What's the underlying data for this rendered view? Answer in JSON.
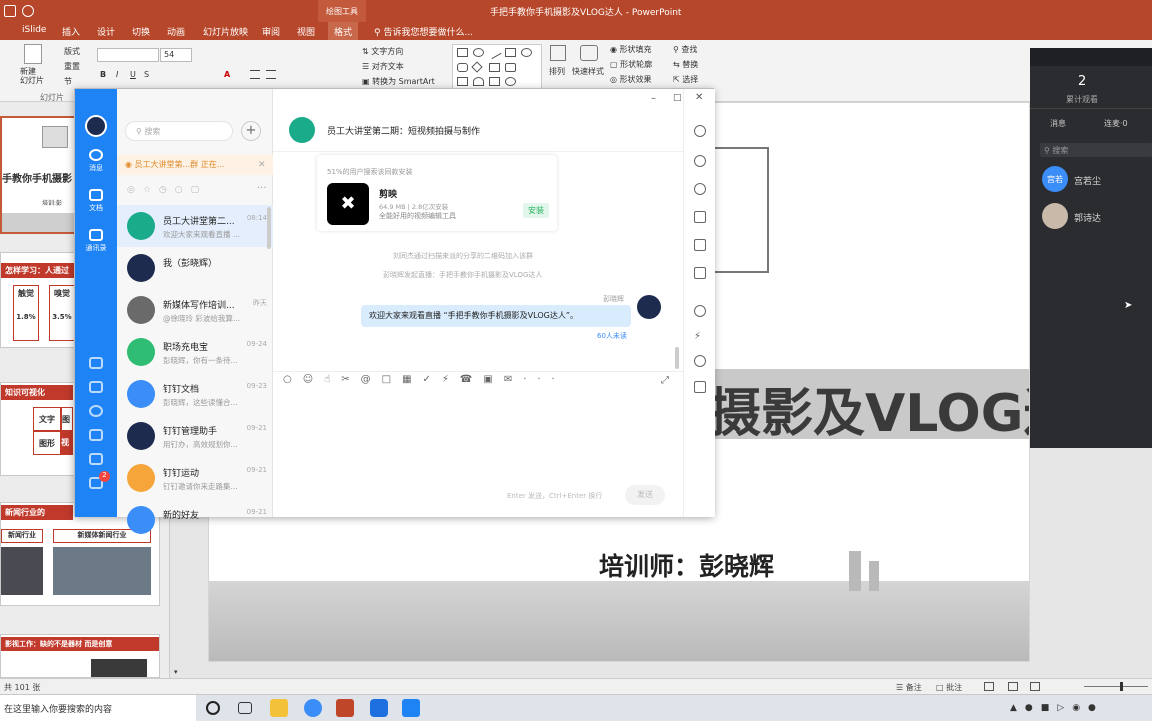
{
  "ppt": {
    "title": "手把手教你手机摄影及VLOG达人 - PowerPoint",
    "contextual_tab": "绘图工具",
    "tabs": [
      "iSlide",
      "插入",
      "设计",
      "切换",
      "动画",
      "幻灯片放映",
      "审阅",
      "视图",
      "格式"
    ],
    "tell_me": "告诉我您想要做什么...",
    "ribbon": {
      "new_slide": "新建\n幻灯片",
      "layout": "版式",
      "reset": "重置",
      "section": "节",
      "group_slides": "幻灯片",
      "font_size": "54",
      "text_direction": "文字方向",
      "align_text": "对齐文本",
      "smartart": "转换为 SmartArt",
      "arrange": "排列",
      "quick_styles": "快速样式",
      "shape_fill": "形状填充",
      "shape_outline": "形状轮廓",
      "shape_effects": "形状效果",
      "find": "查找",
      "replace": "替换",
      "select": "选择"
    },
    "thumbs": {
      "s1_title": "手教你手机摄影",
      "s1_sub": "培训:彭",
      "s2_title": "怎样学习：人通过",
      "s2_cols": [
        "触觉",
        "嗅觉"
      ],
      "s2_vals": [
        "1.8%",
        "3.5%"
      ],
      "s3_title": "知识可视化",
      "s3_cells": [
        "文字",
        "图",
        "图形",
        "视"
      ],
      "s4_title": "新闻行业的",
      "s4_a": "新闻行业",
      "s4_b": "新媒体新闻行业",
      "s5_title": "影视工作：缺的不是器材 而是创意"
    },
    "slide": {
      "big_text": "摄影及VLOG达",
      "trainer": "培训师：彭晓辉"
    },
    "status": {
      "slide_count": "共 101 张",
      "notes": "备注",
      "comments": "批注"
    }
  },
  "dingtalk": {
    "rail": [
      {
        "label": "消息",
        "icon": "message-icon"
      },
      {
        "label": "文档",
        "icon": "document-icon"
      },
      {
        "label": "通讯录",
        "icon": "contacts-icon"
      }
    ],
    "rail_badge": "2",
    "search_placeholder": "搜索",
    "notice": "员工大讲堂第...群 正在...",
    "conversations": [
      {
        "name": "员工大讲堂第二...",
        "preview": "欢迎大家来观看直播 ...",
        "time": "08:14",
        "color": "#1aab8a"
      },
      {
        "name": "我（彭晓辉）",
        "preview": "",
        "time": "",
        "color": "#1d2b4f"
      },
      {
        "name": "新媒体写作培训...",
        "preview": "@徐晓玲 彩波给我算...",
        "time": "昨天",
        "color": "#6a6a6a"
      },
      {
        "name": "职场充电宝",
        "preview": "彭晓辉，你有一条待...",
        "time": "09-24",
        "color": "#2ebd73"
      },
      {
        "name": "钉钉文档",
        "preview": "彭晓辉，这些读懂合...",
        "time": "09-23",
        "color": "#3b8df7"
      },
      {
        "name": "钉钉管理助手",
        "preview": "用钉办，高效规划你...",
        "time": "09-21",
        "color": "#1d2b4f"
      },
      {
        "name": "钉钉运动",
        "preview": "钉钉邀请你来走路集...",
        "time": "09-21",
        "color": "#f6a53a"
      },
      {
        "name": "新的好友",
        "preview": "",
        "time": "09-21",
        "color": "#3b8df7"
      }
    ],
    "chat": {
      "title": "员工大讲堂第二期：短视频拍摄与制作",
      "app_card": {
        "header": "51%的用户搜索该同款安装",
        "name": "剪映",
        "meta": "64.9 MB | 2.8亿次安装",
        "desc": "全能好用的视频编辑工具",
        "install": "安装"
      },
      "system1": "刘同杰通过扫描来派的分享的二维码加入该群",
      "system2": "彭晓辉发起直播：手把手教你手机摄影及VLOG达人",
      "sender": "彭晓辉",
      "message": "欢迎大家来观看直播 “手把手教你手机摄影及VLOG达人”。",
      "unread": "60人未读",
      "input_hint": "Enter 发送，Ctrl+Enter 换行",
      "send": "发送"
    }
  },
  "live": {
    "count": "2",
    "count_label": "累计观看",
    "tab_msgs": "消息",
    "tab_mic": "连麦·0",
    "search": "搜索",
    "viewers": [
      {
        "name": "宫若尘",
        "avatar_text": "宫若",
        "color": "#3b8df7"
      },
      {
        "name": "郭诗达",
        "avatar_text": "",
        "color": "#c9b9a8"
      }
    ]
  },
  "taskbar": {
    "search_placeholder": "在这里输入你要搜索的内容"
  }
}
